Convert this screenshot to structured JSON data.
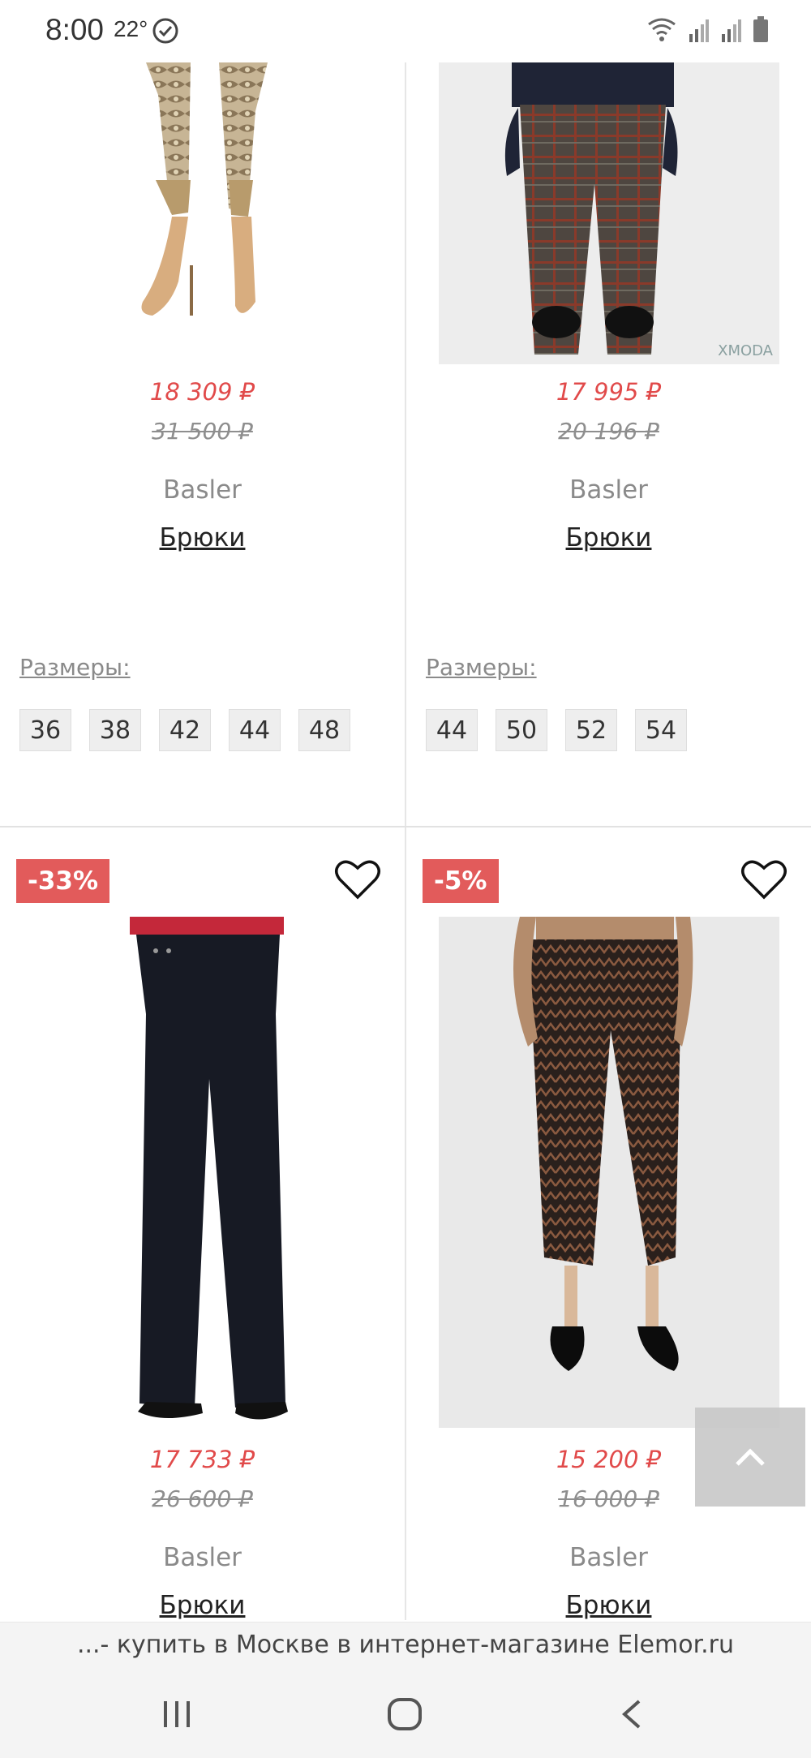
{
  "status_bar": {
    "time": "8:00",
    "temperature": "22°",
    "icons": [
      "check-circle-icon",
      "wifi-icon",
      "signal-icon",
      "signal-icon",
      "battery-icon"
    ]
  },
  "products": [
    {
      "price": "18 309 ₽",
      "old_price": "31 500 ₽",
      "brand": "Basler",
      "name": "Брюки",
      "sizes_label": "Размеры:",
      "sizes": [
        "36",
        "38",
        "42",
        "44",
        "48"
      ]
    },
    {
      "price": "17 995 ₽",
      "old_price": "20 196 ₽",
      "brand": "Basler",
      "name": "Брюки",
      "watermark": "XMODA",
      "sizes_label": "Размеры:",
      "sizes": [
        "44",
        "50",
        "52",
        "54"
      ]
    },
    {
      "badge": "-33%",
      "price": "17 733 ₽",
      "old_price": "26 600 ₽",
      "brand": "Basler",
      "name": "Брюки"
    },
    {
      "badge": "-5%",
      "price": "15 200 ₽",
      "old_price": "16 000 ₽",
      "brand": "Basler",
      "name": "Брюки"
    }
  ],
  "url_bar": {
    "text": "...- купить в Москве в интернет-магазине Elemor.ru"
  },
  "nav_bar": {
    "icons": [
      "recent-apps-icon",
      "home-icon",
      "back-icon"
    ]
  },
  "colors": {
    "sale_price": "#e14a4a",
    "badge": "#e25b5b"
  }
}
